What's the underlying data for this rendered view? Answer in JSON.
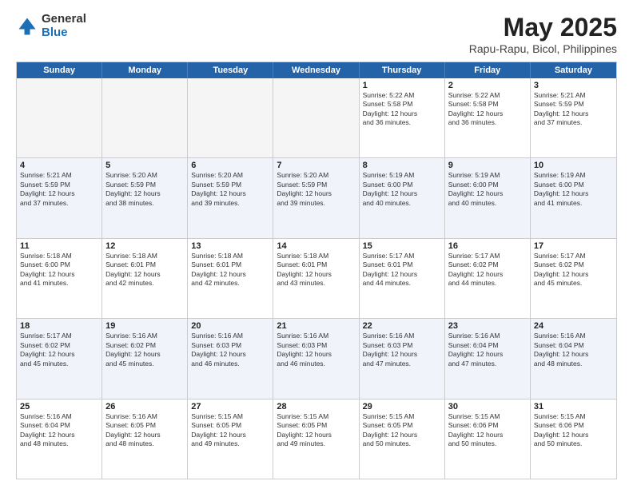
{
  "logo": {
    "general": "General",
    "blue": "Blue"
  },
  "title": "May 2025",
  "subtitle": "Rapu-Rapu, Bicol, Philippines",
  "days": [
    "Sunday",
    "Monday",
    "Tuesday",
    "Wednesday",
    "Thursday",
    "Friday",
    "Saturday"
  ],
  "weeks": [
    [
      {
        "day": "",
        "empty": true
      },
      {
        "day": "",
        "empty": true
      },
      {
        "day": "",
        "empty": true
      },
      {
        "day": "",
        "empty": true
      },
      {
        "day": "1",
        "line1": "Sunrise: 5:22 AM",
        "line2": "Sunset: 5:58 PM",
        "line3": "Daylight: 12 hours",
        "line4": "and 36 minutes."
      },
      {
        "day": "2",
        "line1": "Sunrise: 5:22 AM",
        "line2": "Sunset: 5:58 PM",
        "line3": "Daylight: 12 hours",
        "line4": "and 36 minutes."
      },
      {
        "day": "3",
        "line1": "Sunrise: 5:21 AM",
        "line2": "Sunset: 5:59 PM",
        "line3": "Daylight: 12 hours",
        "line4": "and 37 minutes."
      }
    ],
    [
      {
        "day": "4",
        "line1": "Sunrise: 5:21 AM",
        "line2": "Sunset: 5:59 PM",
        "line3": "Daylight: 12 hours",
        "line4": "and 37 minutes."
      },
      {
        "day": "5",
        "line1": "Sunrise: 5:20 AM",
        "line2": "Sunset: 5:59 PM",
        "line3": "Daylight: 12 hours",
        "line4": "and 38 minutes."
      },
      {
        "day": "6",
        "line1": "Sunrise: 5:20 AM",
        "line2": "Sunset: 5:59 PM",
        "line3": "Daylight: 12 hours",
        "line4": "and 39 minutes."
      },
      {
        "day": "7",
        "line1": "Sunrise: 5:20 AM",
        "line2": "Sunset: 5:59 PM",
        "line3": "Daylight: 12 hours",
        "line4": "and 39 minutes."
      },
      {
        "day": "8",
        "line1": "Sunrise: 5:19 AM",
        "line2": "Sunset: 6:00 PM",
        "line3": "Daylight: 12 hours",
        "line4": "and 40 minutes."
      },
      {
        "day": "9",
        "line1": "Sunrise: 5:19 AM",
        "line2": "Sunset: 6:00 PM",
        "line3": "Daylight: 12 hours",
        "line4": "and 40 minutes."
      },
      {
        "day": "10",
        "line1": "Sunrise: 5:19 AM",
        "line2": "Sunset: 6:00 PM",
        "line3": "Daylight: 12 hours",
        "line4": "and 41 minutes."
      }
    ],
    [
      {
        "day": "11",
        "line1": "Sunrise: 5:18 AM",
        "line2": "Sunset: 6:00 PM",
        "line3": "Daylight: 12 hours",
        "line4": "and 41 minutes."
      },
      {
        "day": "12",
        "line1": "Sunrise: 5:18 AM",
        "line2": "Sunset: 6:01 PM",
        "line3": "Daylight: 12 hours",
        "line4": "and 42 minutes."
      },
      {
        "day": "13",
        "line1": "Sunrise: 5:18 AM",
        "line2": "Sunset: 6:01 PM",
        "line3": "Daylight: 12 hours",
        "line4": "and 42 minutes."
      },
      {
        "day": "14",
        "line1": "Sunrise: 5:18 AM",
        "line2": "Sunset: 6:01 PM",
        "line3": "Daylight: 12 hours",
        "line4": "and 43 minutes."
      },
      {
        "day": "15",
        "line1": "Sunrise: 5:17 AM",
        "line2": "Sunset: 6:01 PM",
        "line3": "Daylight: 12 hours",
        "line4": "and 44 minutes."
      },
      {
        "day": "16",
        "line1": "Sunrise: 5:17 AM",
        "line2": "Sunset: 6:02 PM",
        "line3": "Daylight: 12 hours",
        "line4": "and 44 minutes."
      },
      {
        "day": "17",
        "line1": "Sunrise: 5:17 AM",
        "line2": "Sunset: 6:02 PM",
        "line3": "Daylight: 12 hours",
        "line4": "and 45 minutes."
      }
    ],
    [
      {
        "day": "18",
        "line1": "Sunrise: 5:17 AM",
        "line2": "Sunset: 6:02 PM",
        "line3": "Daylight: 12 hours",
        "line4": "and 45 minutes."
      },
      {
        "day": "19",
        "line1": "Sunrise: 5:16 AM",
        "line2": "Sunset: 6:02 PM",
        "line3": "Daylight: 12 hours",
        "line4": "and 45 minutes."
      },
      {
        "day": "20",
        "line1": "Sunrise: 5:16 AM",
        "line2": "Sunset: 6:03 PM",
        "line3": "Daylight: 12 hours",
        "line4": "and 46 minutes."
      },
      {
        "day": "21",
        "line1": "Sunrise: 5:16 AM",
        "line2": "Sunset: 6:03 PM",
        "line3": "Daylight: 12 hours",
        "line4": "and 46 minutes."
      },
      {
        "day": "22",
        "line1": "Sunrise: 5:16 AM",
        "line2": "Sunset: 6:03 PM",
        "line3": "Daylight: 12 hours",
        "line4": "and 47 minutes."
      },
      {
        "day": "23",
        "line1": "Sunrise: 5:16 AM",
        "line2": "Sunset: 6:04 PM",
        "line3": "Daylight: 12 hours",
        "line4": "and 47 minutes."
      },
      {
        "day": "24",
        "line1": "Sunrise: 5:16 AM",
        "line2": "Sunset: 6:04 PM",
        "line3": "Daylight: 12 hours",
        "line4": "and 48 minutes."
      }
    ],
    [
      {
        "day": "25",
        "line1": "Sunrise: 5:16 AM",
        "line2": "Sunset: 6:04 PM",
        "line3": "Daylight: 12 hours",
        "line4": "and 48 minutes."
      },
      {
        "day": "26",
        "line1": "Sunrise: 5:16 AM",
        "line2": "Sunset: 6:05 PM",
        "line3": "Daylight: 12 hours",
        "line4": "and 48 minutes."
      },
      {
        "day": "27",
        "line1": "Sunrise: 5:15 AM",
        "line2": "Sunset: 6:05 PM",
        "line3": "Daylight: 12 hours",
        "line4": "and 49 minutes."
      },
      {
        "day": "28",
        "line1": "Sunrise: 5:15 AM",
        "line2": "Sunset: 6:05 PM",
        "line3": "Daylight: 12 hours",
        "line4": "and 49 minutes."
      },
      {
        "day": "29",
        "line1": "Sunrise: 5:15 AM",
        "line2": "Sunset: 6:05 PM",
        "line3": "Daylight: 12 hours",
        "line4": "and 50 minutes."
      },
      {
        "day": "30",
        "line1": "Sunrise: 5:15 AM",
        "line2": "Sunset: 6:06 PM",
        "line3": "Daylight: 12 hours",
        "line4": "and 50 minutes."
      },
      {
        "day": "31",
        "line1": "Sunrise: 5:15 AM",
        "line2": "Sunset: 6:06 PM",
        "line3": "Daylight: 12 hours",
        "line4": "and 50 minutes."
      }
    ]
  ]
}
